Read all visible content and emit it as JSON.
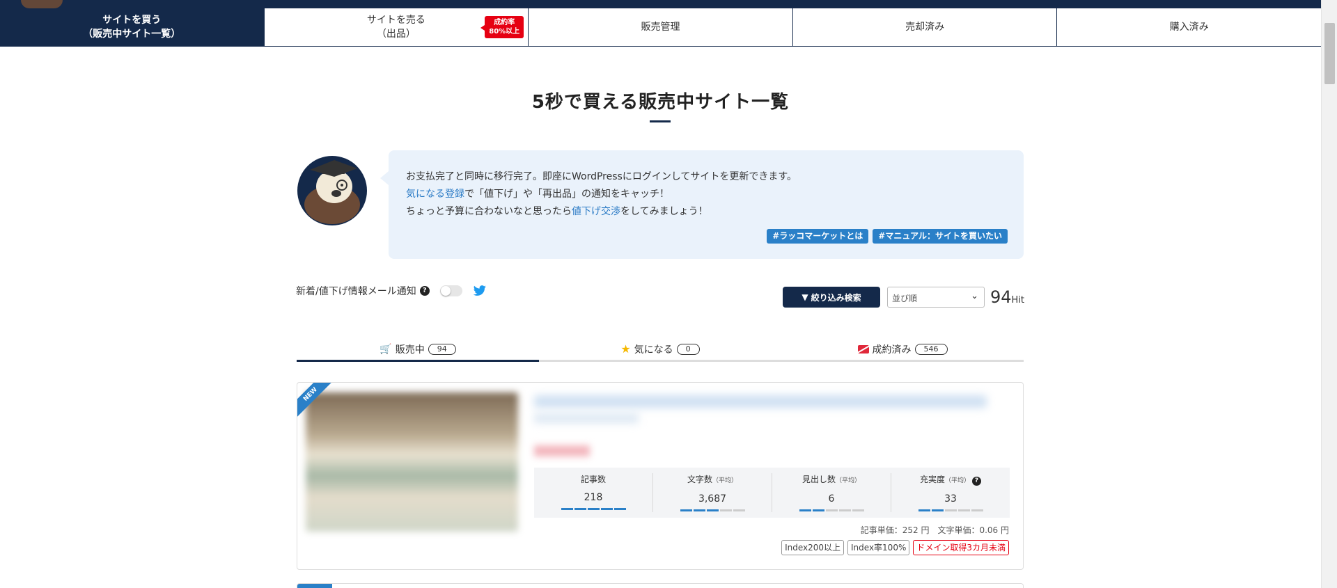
{
  "nav": {
    "tabs": [
      {
        "line1": "サイトを買う",
        "line2": "（販売中サイト一覧）"
      },
      {
        "line1": "サイトを売る",
        "line2": "（出品）"
      },
      {
        "line1": "販売管理",
        "line2": ""
      },
      {
        "line1": "売却済み",
        "line2": ""
      },
      {
        "line1": "購入済み",
        "line2": ""
      }
    ],
    "success_badge": {
      "line1": "成約率",
      "line2": "80%以上"
    }
  },
  "page_title": "5秒で買える販売中サイト一覧",
  "intro": {
    "line1": "お支払完了と同時に移行完了。即座にWordPressにログインしてサイトを更新できます。",
    "line2_link": "気になる登録",
    "line2_rest": "で「値下げ」や「再出品」の通知をキャッチ！",
    "line3_pre": "ちょっと予算に合わないなと思ったら",
    "line3_link": "値下げ交渉",
    "line3_post": "をしてみましょう！",
    "tags": [
      "#ラッコマーケットとは",
      "#マニュアル：サイトを買いたい"
    ]
  },
  "notify": {
    "label": "新着/値下げ情報メール通知",
    "help": "?",
    "enabled": false
  },
  "filter": {
    "button_label": "絞り込み検索",
    "sort_value": "並び順",
    "hit_count": "94",
    "hit_unit": "Hit"
  },
  "status_tabs": [
    {
      "label": "販売中",
      "count": "94",
      "icon": "cart-icon"
    },
    {
      "label": "気になる",
      "count": "0",
      "icon": "star-icon"
    },
    {
      "label": "成約済み",
      "count": "546",
      "icon": "closed-icon"
    }
  ],
  "listing": {
    "ribbon": "NEW",
    "stats": [
      {
        "label": "記事数",
        "sub": "",
        "value": "218",
        "level": 5
      },
      {
        "label": "文字数",
        "sub": "（平均）",
        "value": "3,687",
        "level": 3
      },
      {
        "label": "見出し数",
        "sub": "（平均）",
        "value": "6",
        "level": 2
      },
      {
        "label": "充実度",
        "sub": "（平均）",
        "value": "33",
        "level": 2
      }
    ],
    "unit_price": "記事単価：252 円　文字単価：0.06 円",
    "badges": [
      "Index200以上",
      "Index率100%",
      "ドメイン取得3カ月未満"
    ]
  },
  "colors": {
    "navy": "#14294a",
    "accent_blue": "#2a80c8",
    "alert_red": "#e60012"
  }
}
